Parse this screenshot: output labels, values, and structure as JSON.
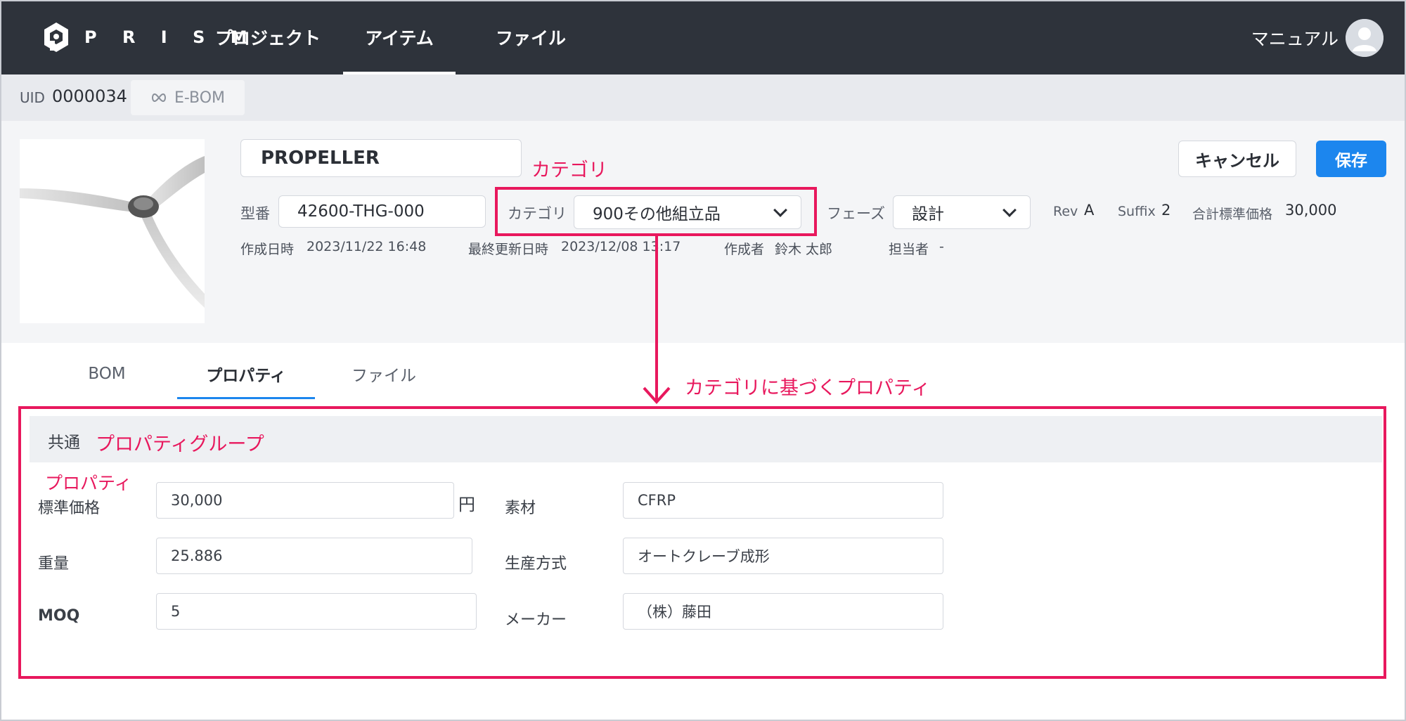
{
  "nav": {
    "brand": "P R I S M",
    "items": [
      {
        "label": "プロジェクト"
      },
      {
        "label": "アイテム"
      },
      {
        "label": "ファイル"
      }
    ],
    "user_label": "マニュアル"
  },
  "uid": {
    "label": "UID",
    "value": "0000034",
    "ebom_label": "E-BOM"
  },
  "item": {
    "name": "PROPELLER",
    "model_label": "型番",
    "model_value": "42600-THG-000",
    "category_label": "カテゴリ",
    "category_value": "900その他組立品",
    "phase_label": "フェーズ",
    "phase_value": "設計",
    "rev_label": "Rev",
    "rev_value": "A",
    "suffix_label": "Suffix",
    "suffix_value": "2",
    "total_price_label": "合計標準価格",
    "total_price_value": "30,000",
    "cancel_label": "キャンセル",
    "save_label": "保存",
    "created_label": "作成日時",
    "created_value": "2023/11/22 16:48",
    "updated_label": "最終更新日時",
    "updated_value": "2023/12/08 13:17",
    "author_label": "作成者",
    "author_value": "鈴木 太郎",
    "assignee_label": "担当者",
    "assignee_value": "-"
  },
  "tabs": [
    {
      "label": "BOM"
    },
    {
      "label": "プロパティ"
    },
    {
      "label": "ファイル"
    }
  ],
  "properties": {
    "group_label": "共通",
    "fields": [
      {
        "label": "標準価格",
        "value": "30,000",
        "unit": "円"
      },
      {
        "label": "重量",
        "value": "25.886"
      },
      {
        "label": "MOQ",
        "value": "5"
      },
      {
        "label": "素材",
        "value": "CFRP"
      },
      {
        "label": "生産方式",
        "value": "オートクレーブ成形"
      },
      {
        "label": "メーカー",
        "value": "（株）藤田"
      }
    ]
  },
  "annotations": {
    "category": "カテゴリ",
    "category_props": "カテゴリに基づくプロパティ",
    "property_group": "プロパティグループ",
    "property": "プロパティ",
    "color": "#e8185d"
  },
  "colors": {
    "nav_bg": "#2e333b",
    "accent": "#1c86ee"
  },
  "icons": {
    "logo": "prism-logo-icon",
    "user": "user-avatar-icon",
    "ebom": "infinity-icon",
    "dropdown": "chevron-down-icon"
  }
}
